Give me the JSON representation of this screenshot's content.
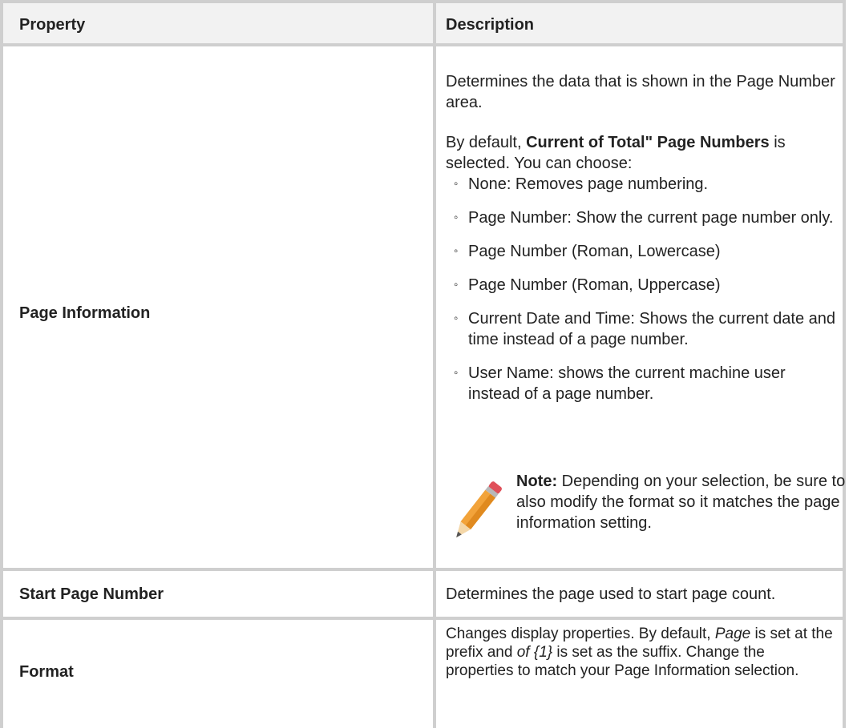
{
  "header": {
    "property": "Property",
    "description": "Description"
  },
  "rows": [
    {
      "label": "Page Information",
      "intro": "Determines the data that is shown in the Page Number area.",
      "default_prefix": "By default, ",
      "default_bold": "Current of Total\" Page Numbers",
      "default_suffix": " is selected. You can choose:",
      "options": [
        "None: Removes page numbering.",
        "Page Number: Show the current page number only.",
        "Page Number (Roman, Lowercase)",
        "Page Number (Roman, Uppercase)",
        "Current Date and Time: Shows the current date and time instead of a page number.",
        "User Name: shows the current machine user instead of a page number."
      ],
      "bullet": "◦",
      "note_label": "Note:",
      "note_text": " Depending on your selection, be sure to also modify the format so it matches the page information setting.",
      "note_icon": "pencil-icon"
    },
    {
      "label": "Start Page Number",
      "description": "Determines the page used to start page count."
    },
    {
      "label": "Format",
      "d1": "Changes display properties. By default, ",
      "d_italic1": "Page",
      "d2": " is set at the prefix and ",
      "d_italic2": "of {1}",
      "d3": " is set as the suffix. Change the properties to match your Page Information selection."
    }
  ],
  "colors": {
    "border": "#cfcfcf",
    "header_bg": "#f2f2f2",
    "text": "#222222"
  }
}
